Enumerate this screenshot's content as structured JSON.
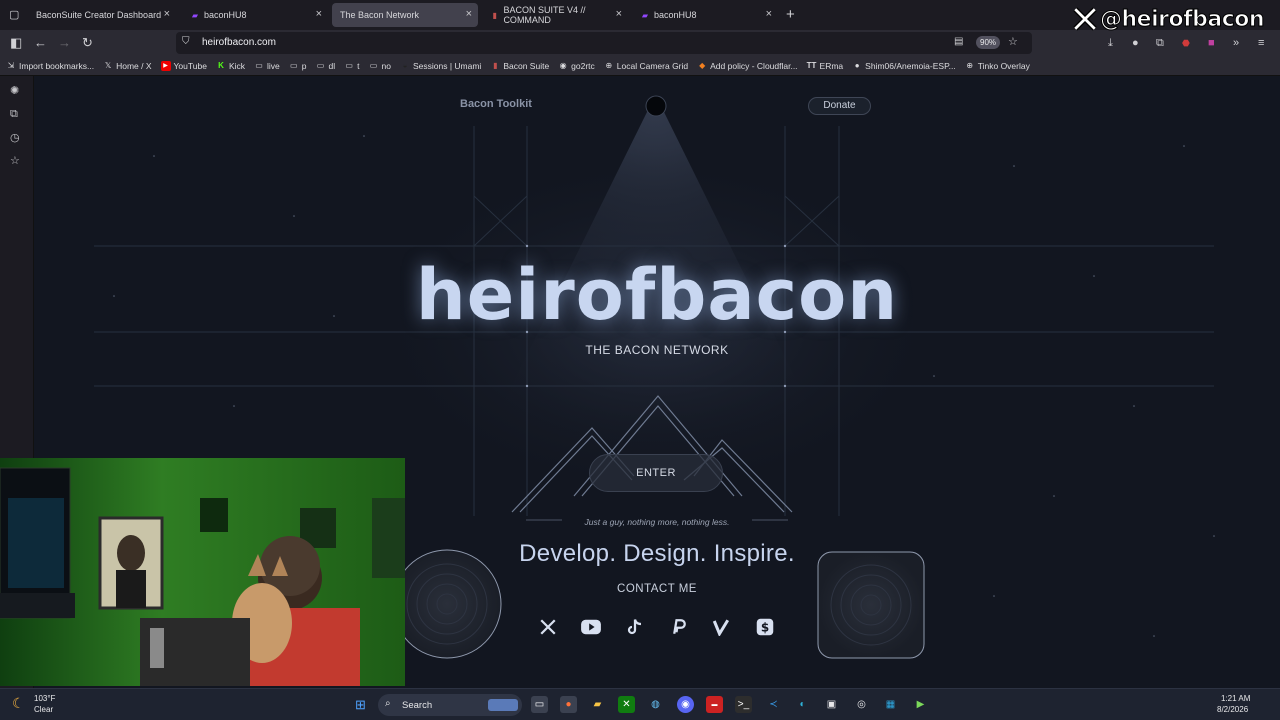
{
  "tabs": [
    {
      "label": "BaconSuite Creator Dashboard",
      "icon": "page-icon",
      "active": false
    },
    {
      "label": "baconHU8",
      "icon": "twitch-icon",
      "active": false
    },
    {
      "label": "The Bacon Network",
      "icon": "none",
      "active": true
    },
    {
      "label": "BACON SUITE V4 // COMMAND",
      "icon": "bacon-icon",
      "active": false
    },
    {
      "label": "baconHU8",
      "icon": "twitch-icon",
      "active": false
    }
  ],
  "navbar": {
    "url": "heirofbacon.com",
    "zoom": "90%"
  },
  "bookmarks": [
    {
      "label": "Import bookmarks...",
      "icon": "import-icon"
    },
    {
      "label": "Home / X",
      "icon": "x-icon"
    },
    {
      "label": "YouTube",
      "icon": "youtube-icon"
    },
    {
      "label": "Kick",
      "icon": "kick-icon"
    },
    {
      "label": "live",
      "icon": "folder-icon"
    },
    {
      "label": "p",
      "icon": "folder-icon"
    },
    {
      "label": "dl",
      "icon": "folder-icon"
    },
    {
      "label": "t",
      "icon": "folder-icon"
    },
    {
      "label": "no",
      "icon": "folder-icon"
    },
    {
      "label": "Sessions | Umami",
      "icon": "umami-icon"
    },
    {
      "label": "Bacon Suite",
      "icon": "bacon-icon"
    },
    {
      "label": "go2rtc",
      "icon": "go2rtc-icon"
    },
    {
      "label": "Local Camera Grid",
      "icon": "globe-icon"
    },
    {
      "label": "Add policy - Cloudflar...",
      "icon": "cloudflare-icon"
    },
    {
      "label": "ERma",
      "icon": "erma-icon"
    },
    {
      "label": "Shim06/Anemoia-ESP...",
      "icon": "github-icon"
    },
    {
      "label": "Tinko Overlay",
      "icon": "globe-icon"
    }
  ],
  "site": {
    "brand": "Bacon Toolkit",
    "donate_label": "Donate",
    "title": "heirofbacon",
    "subtitle": "THE BACON NETWORK",
    "enter_label": "ENTER",
    "tagline": "Just a guy, nothing more, nothing less.",
    "headline": "Develop. Design. Inspire.",
    "contact_label": "CONTACT ME",
    "socials": [
      "x-icon",
      "youtube-icon",
      "tiktok-icon",
      "paypal-icon",
      "venmo-icon",
      "cashapp-icon"
    ]
  },
  "overlay": {
    "watermark": "@heirofbacon"
  },
  "taskbar": {
    "temperature": "103°F",
    "condition": "Clear",
    "search_label": "Search",
    "time": "1:21 AM",
    "date": "8/2/2026"
  }
}
